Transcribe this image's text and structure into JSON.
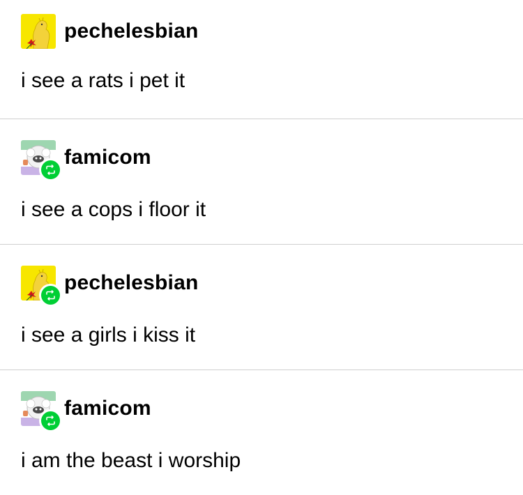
{
  "colors": {
    "divider": "#cfcfcf",
    "reblog_badge": "#00cf35",
    "text": "#000000",
    "background": "#ffffff"
  },
  "posts": [
    {
      "username": "pechelesbian",
      "avatar": "moomin-yellow-avatar",
      "reblog_icon": false,
      "text": "i see a rats i pet it"
    },
    {
      "username": "famicom",
      "avatar": "fluffy-creature-avatar",
      "reblog_icon": true,
      "text": "i see a cops i floor it"
    },
    {
      "username": "pechelesbian",
      "avatar": "moomin-yellow-avatar",
      "reblog_icon": true,
      "text": "i see a girls i kiss it"
    },
    {
      "username": "famicom",
      "avatar": "fluffy-creature-avatar",
      "reblog_icon": true,
      "text": "i am the beast i worship"
    }
  ]
}
